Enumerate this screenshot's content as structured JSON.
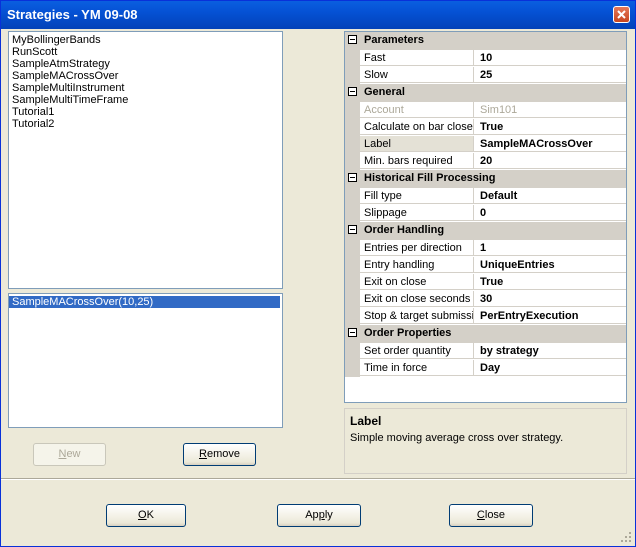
{
  "window": {
    "title": "Strategies - YM 09-08"
  },
  "strategies_list": {
    "items": [
      "MyBollingerBands",
      "RunScott",
      "SampleAtmStrategy",
      "SampleMACrossOver",
      "SampleMultiInstrument",
      "SampleMultiTimeFrame",
      "Tutorial1",
      "Tutorial2"
    ]
  },
  "instances_list": {
    "items": [
      "SampleMACrossOver(10,25)"
    ]
  },
  "buttons": {
    "new_pre": "",
    "new_u": "N",
    "new_post": "ew",
    "remove_pre": "",
    "remove_u": "R",
    "remove_post": "emove",
    "ok_pre": "",
    "ok_u": "O",
    "ok_post": "K",
    "apply_pre": "Ap",
    "apply_u": "p",
    "apply_post": "ly",
    "close_pre": "",
    "close_u": "C",
    "close_post": "lose"
  },
  "properties": {
    "parameters": {
      "label": "Parameters",
      "fast_name": "Fast",
      "fast_value": "10",
      "slow_name": "Slow",
      "slow_value": "25"
    },
    "general": {
      "label": "General",
      "account_name": "Account",
      "account_value": "Sim101",
      "calc_name": "Calculate on bar close",
      "calc_value": "True",
      "label_name": "Label",
      "label_value": "SampleMACrossOver",
      "minbars_name": "Min. bars required",
      "minbars_value": "20"
    },
    "historical": {
      "label": "Historical Fill Processing",
      "filltype_name": "Fill type",
      "filltype_value": "Default",
      "slippage_name": "Slippage",
      "slippage_value": "0"
    },
    "order_handling": {
      "label": "Order Handling",
      "entries_name": "Entries per direction",
      "entries_value": "1",
      "entryhandling_name": "Entry handling",
      "entryhandling_value": "UniqueEntries",
      "exit_name": "Exit on close",
      "exit_value": "True",
      "exitsec_name": "Exit on close seconds",
      "exitsec_value": "30",
      "stoptarget_name": "Stop & target submission",
      "stoptarget_value": "PerEntryExecution"
    },
    "order_properties": {
      "label": "Order Properties",
      "qty_name": "Set order quantity",
      "qty_value": "by strategy",
      "tif_name": "Time in force",
      "tif_value": "Day"
    }
  },
  "description": {
    "title": "Label",
    "text": "Simple moving average cross over strategy."
  },
  "colors": {
    "title_bar": "#0551d4",
    "selection": "#316ac5",
    "background": "#ece9d8"
  }
}
